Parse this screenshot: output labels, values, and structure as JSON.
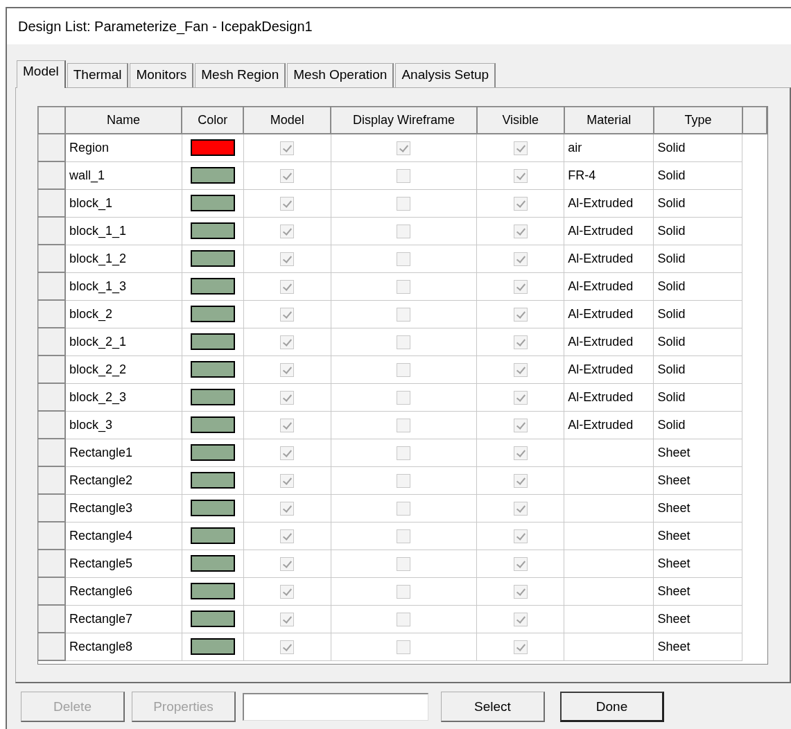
{
  "window": {
    "title": "Design List: Parameterize_Fan - IcepakDesign1"
  },
  "tabs": [
    {
      "label": "Model",
      "selected": true
    },
    {
      "label": "Thermal",
      "selected": false
    },
    {
      "label": "Monitors",
      "selected": false
    },
    {
      "label": "Mesh Region",
      "selected": false
    },
    {
      "label": "Mesh Operation",
      "selected": false
    },
    {
      "label": "Analysis Setup",
      "selected": false
    }
  ],
  "table": {
    "columns": [
      "Name",
      "Color",
      "Model",
      "Display Wireframe",
      "Visible",
      "Material",
      "Type"
    ],
    "rows": [
      {
        "name": "Region",
        "color": "#ff0000",
        "model": true,
        "wireframe": true,
        "visible": true,
        "material": "air",
        "type": "Solid"
      },
      {
        "name": "wall_1",
        "color": "#8fac8f",
        "model": true,
        "wireframe": false,
        "visible": true,
        "material": "FR-4",
        "type": "Solid"
      },
      {
        "name": "block_1",
        "color": "#8fac8f",
        "model": true,
        "wireframe": false,
        "visible": true,
        "material": "Al-Extruded",
        "type": "Solid"
      },
      {
        "name": "block_1_1",
        "color": "#8fac8f",
        "model": true,
        "wireframe": false,
        "visible": true,
        "material": "Al-Extruded",
        "type": "Solid"
      },
      {
        "name": "block_1_2",
        "color": "#8fac8f",
        "model": true,
        "wireframe": false,
        "visible": true,
        "material": "Al-Extruded",
        "type": "Solid"
      },
      {
        "name": "block_1_3",
        "color": "#8fac8f",
        "model": true,
        "wireframe": false,
        "visible": true,
        "material": "Al-Extruded",
        "type": "Solid"
      },
      {
        "name": "block_2",
        "color": "#8fac8f",
        "model": true,
        "wireframe": false,
        "visible": true,
        "material": "Al-Extruded",
        "type": "Solid"
      },
      {
        "name": "block_2_1",
        "color": "#8fac8f",
        "model": true,
        "wireframe": false,
        "visible": true,
        "material": "Al-Extruded",
        "type": "Solid"
      },
      {
        "name": "block_2_2",
        "color": "#8fac8f",
        "model": true,
        "wireframe": false,
        "visible": true,
        "material": "Al-Extruded",
        "type": "Solid"
      },
      {
        "name": "block_2_3",
        "color": "#8fac8f",
        "model": true,
        "wireframe": false,
        "visible": true,
        "material": "Al-Extruded",
        "type": "Solid"
      },
      {
        "name": "block_3",
        "color": "#8fac8f",
        "model": true,
        "wireframe": false,
        "visible": true,
        "material": "Al-Extruded",
        "type": "Solid"
      },
      {
        "name": "Rectangle1",
        "color": "#8fac8f",
        "model": true,
        "wireframe": false,
        "visible": true,
        "type": "Sheet"
      },
      {
        "name": "Rectangle2",
        "color": "#8fac8f",
        "model": true,
        "wireframe": false,
        "visible": true,
        "type": "Sheet"
      },
      {
        "name": "Rectangle3",
        "color": "#8fac8f",
        "model": true,
        "wireframe": false,
        "visible": true,
        "type": "Sheet"
      },
      {
        "name": "Rectangle4",
        "color": "#8fac8f",
        "model": true,
        "wireframe": false,
        "visible": true,
        "type": "Sheet"
      },
      {
        "name": "Rectangle5",
        "color": "#8fac8f",
        "model": true,
        "wireframe": false,
        "visible": true,
        "type": "Sheet"
      },
      {
        "name": "Rectangle6",
        "color": "#8fac8f",
        "model": true,
        "wireframe": false,
        "visible": true,
        "type": "Sheet"
      },
      {
        "name": "Rectangle7",
        "color": "#8fac8f",
        "model": true,
        "wireframe": false,
        "visible": true,
        "type": "Sheet"
      },
      {
        "name": "Rectangle8",
        "color": "#8fac8f",
        "model": true,
        "wireframe": false,
        "visible": true,
        "type": "Sheet"
      }
    ]
  },
  "buttons": [
    {
      "kind": "button",
      "label": "Delete",
      "disabled": true,
      "default": false
    },
    {
      "kind": "button",
      "label": "Properties",
      "disabled": true,
      "default": false
    },
    {
      "kind": "field"
    },
    {
      "kind": "button",
      "label": "Select",
      "disabled": false,
      "default": false
    },
    {
      "kind": "button",
      "label": "Done",
      "disabled": false,
      "default": true
    }
  ]
}
